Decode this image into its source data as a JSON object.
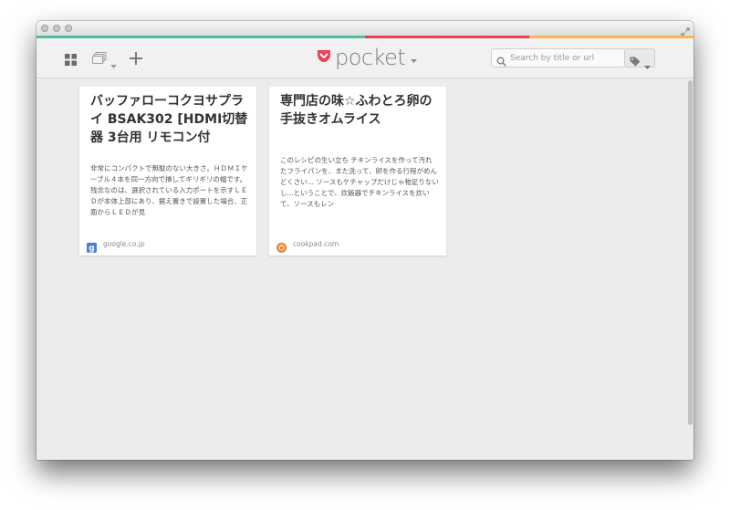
{
  "colors": {
    "bar": [
      "#50bca6",
      "#50bca6",
      "#ef3e56",
      "#fcb64e"
    ],
    "pocket_red": "#ee4056",
    "google_blue": "#4a7fe0",
    "cookpad_orange": "#e6853c"
  },
  "toolbar": {
    "logo_text": "pocket",
    "search_placeholder": "Search by title or url",
    "icons": [
      "grid-view-icon",
      "list-view-icon",
      "chevron-down-icon",
      "plus-icon",
      "search-icon",
      "tag-icon"
    ]
  },
  "cards": [
    {
      "title": "バッファローコクヨサプライ BSAK302 [HDMI切替器 3台用 リモコン付",
      "excerpt": "非常にコンパクトで無駄のない大きさ。ＨＤＭＩケーブル４本を同一方向で挿してギリギリの幅です。残念なのは、選択されている入力ポートを示すＬＥＤが本体上部にあり、据え置きで設置した場合、正面からＬＥＤが見",
      "source": "google.co.jp",
      "favicon": "google-icon"
    },
    {
      "title": "専門店の味☆ふわとろ卵の手抜きオムライス",
      "excerpt": "このレシピの生い立ち チキンライスを作って汚れたフライパンを、また洗って、卵を作る行程がめんどくさい... ソースもケチャップだけじゃ物足りないし...ということで、炊飯器でチキンライスを炊いて、ソースもレン",
      "source": "cookpad.com",
      "favicon": "cookpad-icon"
    }
  ]
}
